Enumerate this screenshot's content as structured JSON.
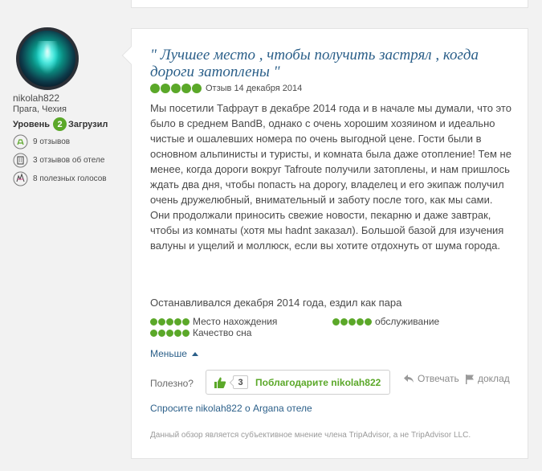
{
  "reviewer": {
    "username": "nikolah822",
    "location": "Прага, Чехия",
    "level_label": "Уровень",
    "level_value": "2",
    "level_suffix": "Загрузил",
    "stats": [
      {
        "icon": "pencil-icon",
        "text": "9 отзывов"
      },
      {
        "icon": "hotel-icon",
        "text": "3 отзывов об отеле"
      },
      {
        "icon": "thumbs-up-icon",
        "text": "8 полезных голосов"
      }
    ]
  },
  "review": {
    "title": "\" Лучшее место , чтобы получить застрял , когда дороги затоплены \"",
    "rating": 5,
    "date_text": "Отзыв 14 декабря 2014",
    "body": "Мы посетили Тафраут в декабре 2014 года и в начале мы думали, что это было в среднем BandB, однако с очень хорошим хозяином и идеально чистые и ошалевших номера по очень выгодной цене. Гости были в основном альпинисты и туристы, и комната была даже отопление! Тем не менее, когда дороги вокруг Tafroute получили затоплены, и нам пришлось ждать два дня, чтобы попасть на дорогу, владелец и его экипаж получил очень дружелюбный, внимательный и заботу после того, как мы сами. Они продолжали приносить свежие новости, пекарню и даже завтрак, чтобы из комнаты (хотя мы hadnt заказал). Большой базой для изучения валуны и ущелий и моллюск, если вы хотите отдохнуть от шума города.",
    "stayed": "Останавливался декабря 2014 года, ездил как пара",
    "subratings": [
      {
        "label": "Место нахождения",
        "rating": 5
      },
      {
        "label": "обслуживание",
        "rating": 5
      },
      {
        "label": "Качество сна",
        "rating": 5
      }
    ],
    "less_label": "Меньше",
    "helpful_label": "Полезно?",
    "thank_count": "3",
    "thank_label": "Поблагодарите nikolah822",
    "reply_label": "Отвечать",
    "report_label": "доклад",
    "ask_link": "Спросите nikolah822 о Argana отеле",
    "disclaimer": "Данный обзор является субъективное мнение члена TripAdvisor, а не TripAdvisor LLC."
  },
  "colors": {
    "accent_green": "#5ba829",
    "link_blue": "#2b5f89",
    "background": "#f2f2f2"
  }
}
